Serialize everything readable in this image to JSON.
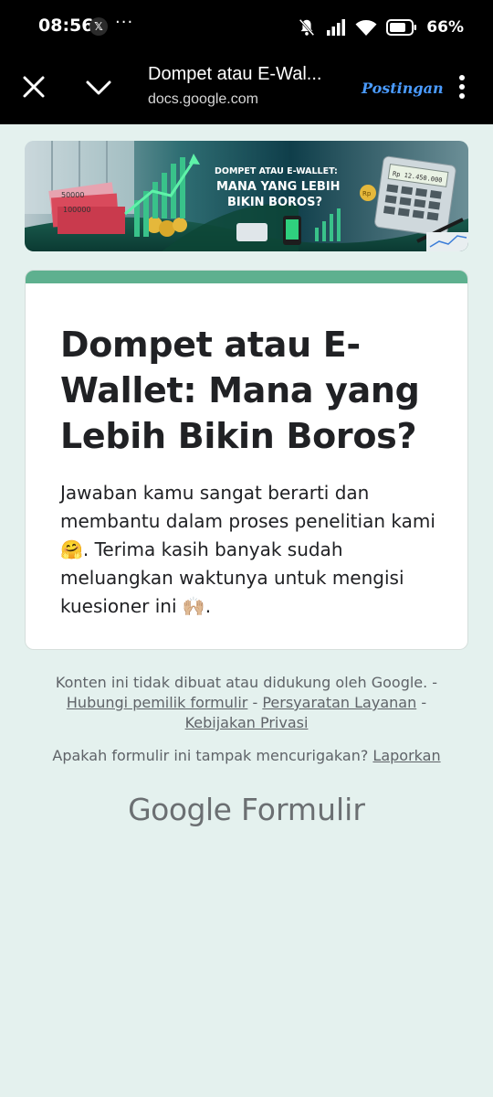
{
  "status_bar": {
    "time": "08:56",
    "x_app": "𝕏",
    "more_dots": "···",
    "battery_pct": "66%"
  },
  "app_bar": {
    "title": "Dompet atau E-Wal...",
    "url": "docs.google.com",
    "action_label": "Postingan"
  },
  "banner": {
    "line1": "DOMPET ATAU E-WALLET:",
    "line2": "MANA YANG LEBIH",
    "line3": "BIKIN BOROS?",
    "calc_display": "Rp 12.450.000",
    "bill1": "50000",
    "bill2": "100000",
    "coin": "Rp"
  },
  "form": {
    "title": "Dompet atau E-Wallet: Mana yang Lebih Bikin Boros?",
    "description": "Jawaban kamu sangat berarti dan membantu dalam proses penelitian kami 🤗. Terima kasih banyak sudah meluangkan waktunya untuk mengisi kuesioner ini 🙌🏼."
  },
  "footer": {
    "disclaimer": "Konten ini tidak dibuat atau didukung oleh Google. -",
    "link_contact": "Hubungi pemilik formulir",
    "sep1": "-",
    "link_terms": "Persyaratan Layanan",
    "sep2": "-",
    "link_privacy": "Kebijakan Privasi",
    "report_text": "Apakah formulir ini tampak mencurigakan?",
    "report_link": "Laporkan"
  },
  "brand": {
    "google": "Google",
    "forms": "Formulir"
  },
  "colors": {
    "page_bg": "#e4f1ee",
    "card_accent": "#5eb08f",
    "action_blue": "#4a9bff"
  }
}
